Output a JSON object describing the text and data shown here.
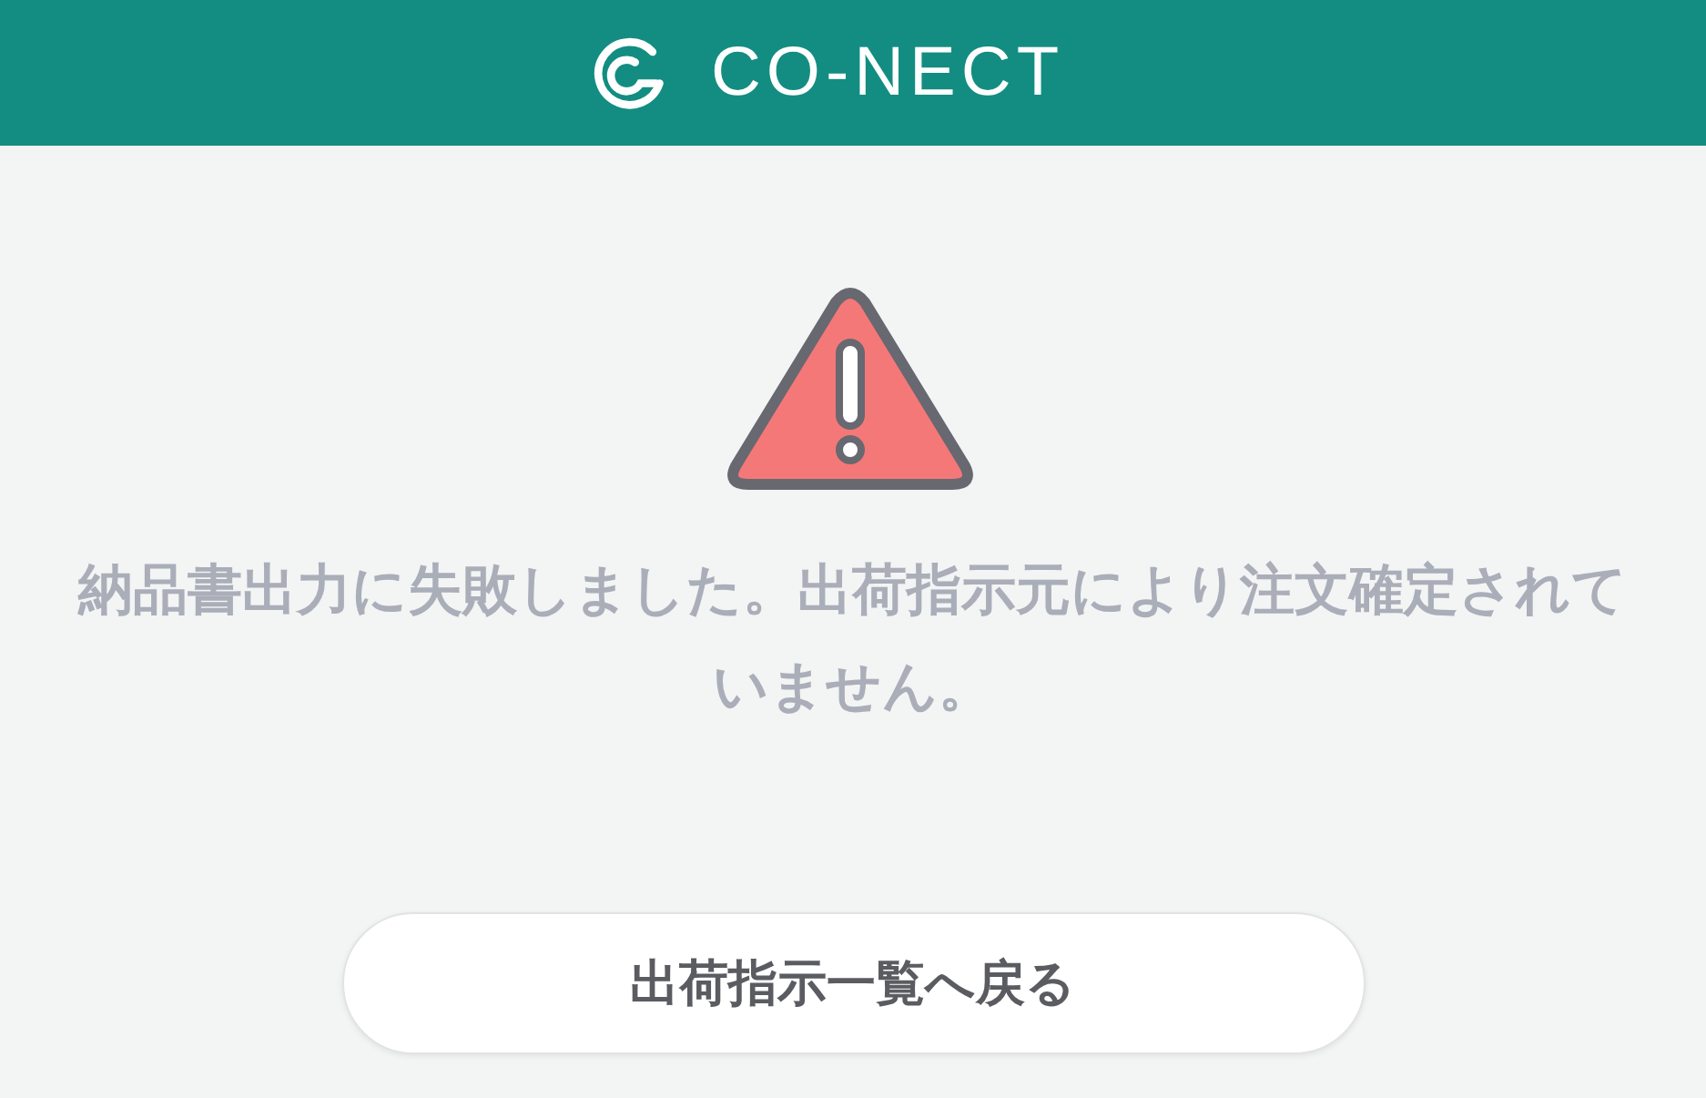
{
  "header": {
    "logo_text": "CO-NECT"
  },
  "message": "納品書出力に失敗しました。出荷指示元により注文確定されていません。",
  "button": {
    "label": "出荷指示一覧へ戻る"
  }
}
